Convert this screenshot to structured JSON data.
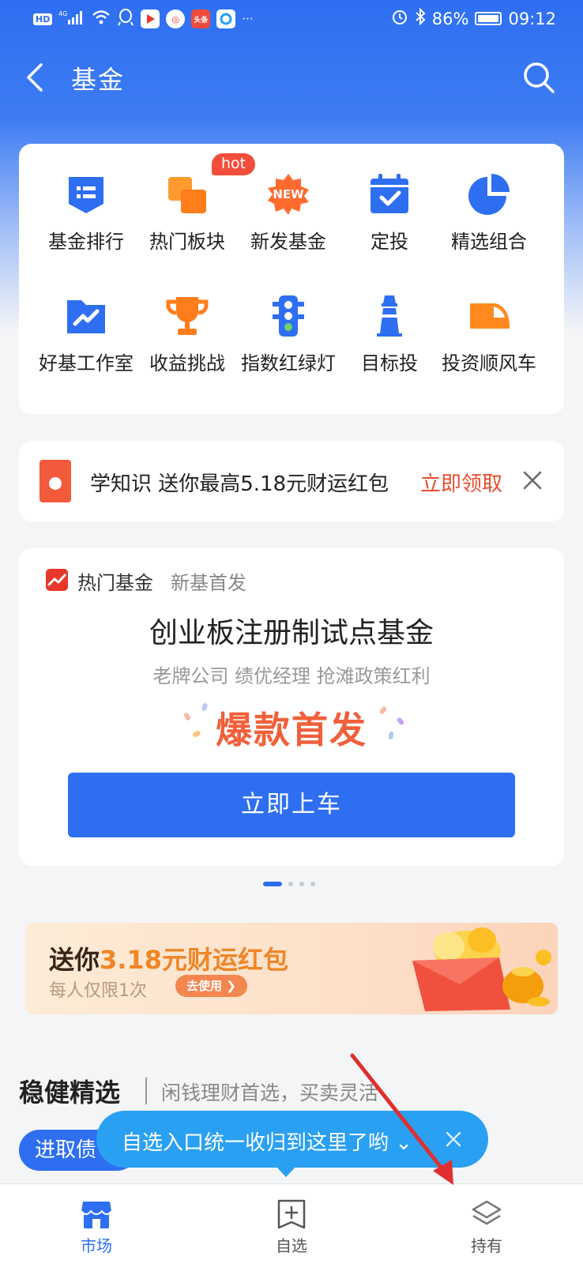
{
  "status_bar": {
    "hd": "HD",
    "signal": "4G",
    "battery": "86%",
    "time": "09:12"
  },
  "header": {
    "title": "基金"
  },
  "grid": {
    "hot_badge": "hot",
    "items": [
      {
        "label": "基金排行",
        "icon": "ranking-icon"
      },
      {
        "label": "热门板块",
        "icon": "hot-sector-icon"
      },
      {
        "label": "新发基金",
        "icon": "new-badge-icon"
      },
      {
        "label": "定投",
        "icon": "calendar-check-icon"
      },
      {
        "label": "精选组合",
        "icon": "pie-chart-icon"
      },
      {
        "label": "好基工作室",
        "icon": "trend-folder-icon"
      },
      {
        "label": "收益挑战",
        "icon": "trophy-icon"
      },
      {
        "label": "指数红绿灯",
        "icon": "traffic-light-icon"
      },
      {
        "label": "目标投",
        "icon": "lighthouse-icon"
      },
      {
        "label": "投资顺风车",
        "icon": "train-icon"
      }
    ]
  },
  "promo": {
    "text": "学知识 送你最高5.18元财运红包",
    "cta": "立即领取"
  },
  "featured": {
    "tag": "热门基金",
    "tag_sub": "新基首发",
    "title": "创业板注册制试点基金",
    "subtitle": "老牌公司 绩优经理 抢滩政策红利",
    "highlight": "爆款首发",
    "button": "立即上车"
  },
  "banner": {
    "title_prefix": "送你",
    "title_amount": "3.18元财运红包",
    "subtitle": "每人仅限1次",
    "button": "去使用 ❯"
  },
  "section": {
    "title": "稳健精选",
    "subtitle": "闲钱理财首选，买卖灵活",
    "chip": "进取债"
  },
  "tooltip": {
    "text": "自选入口统一收归到这里了哟 ⌄"
  },
  "nav": [
    {
      "label": "市场",
      "active": true
    },
    {
      "label": "自选",
      "active": false
    },
    {
      "label": "持有",
      "active": false
    }
  ],
  "colors": {
    "primary": "#2e6ff2",
    "orange": "#ff8a1f",
    "red": "#e84e2f",
    "tooltip": "#2aa0f2"
  }
}
